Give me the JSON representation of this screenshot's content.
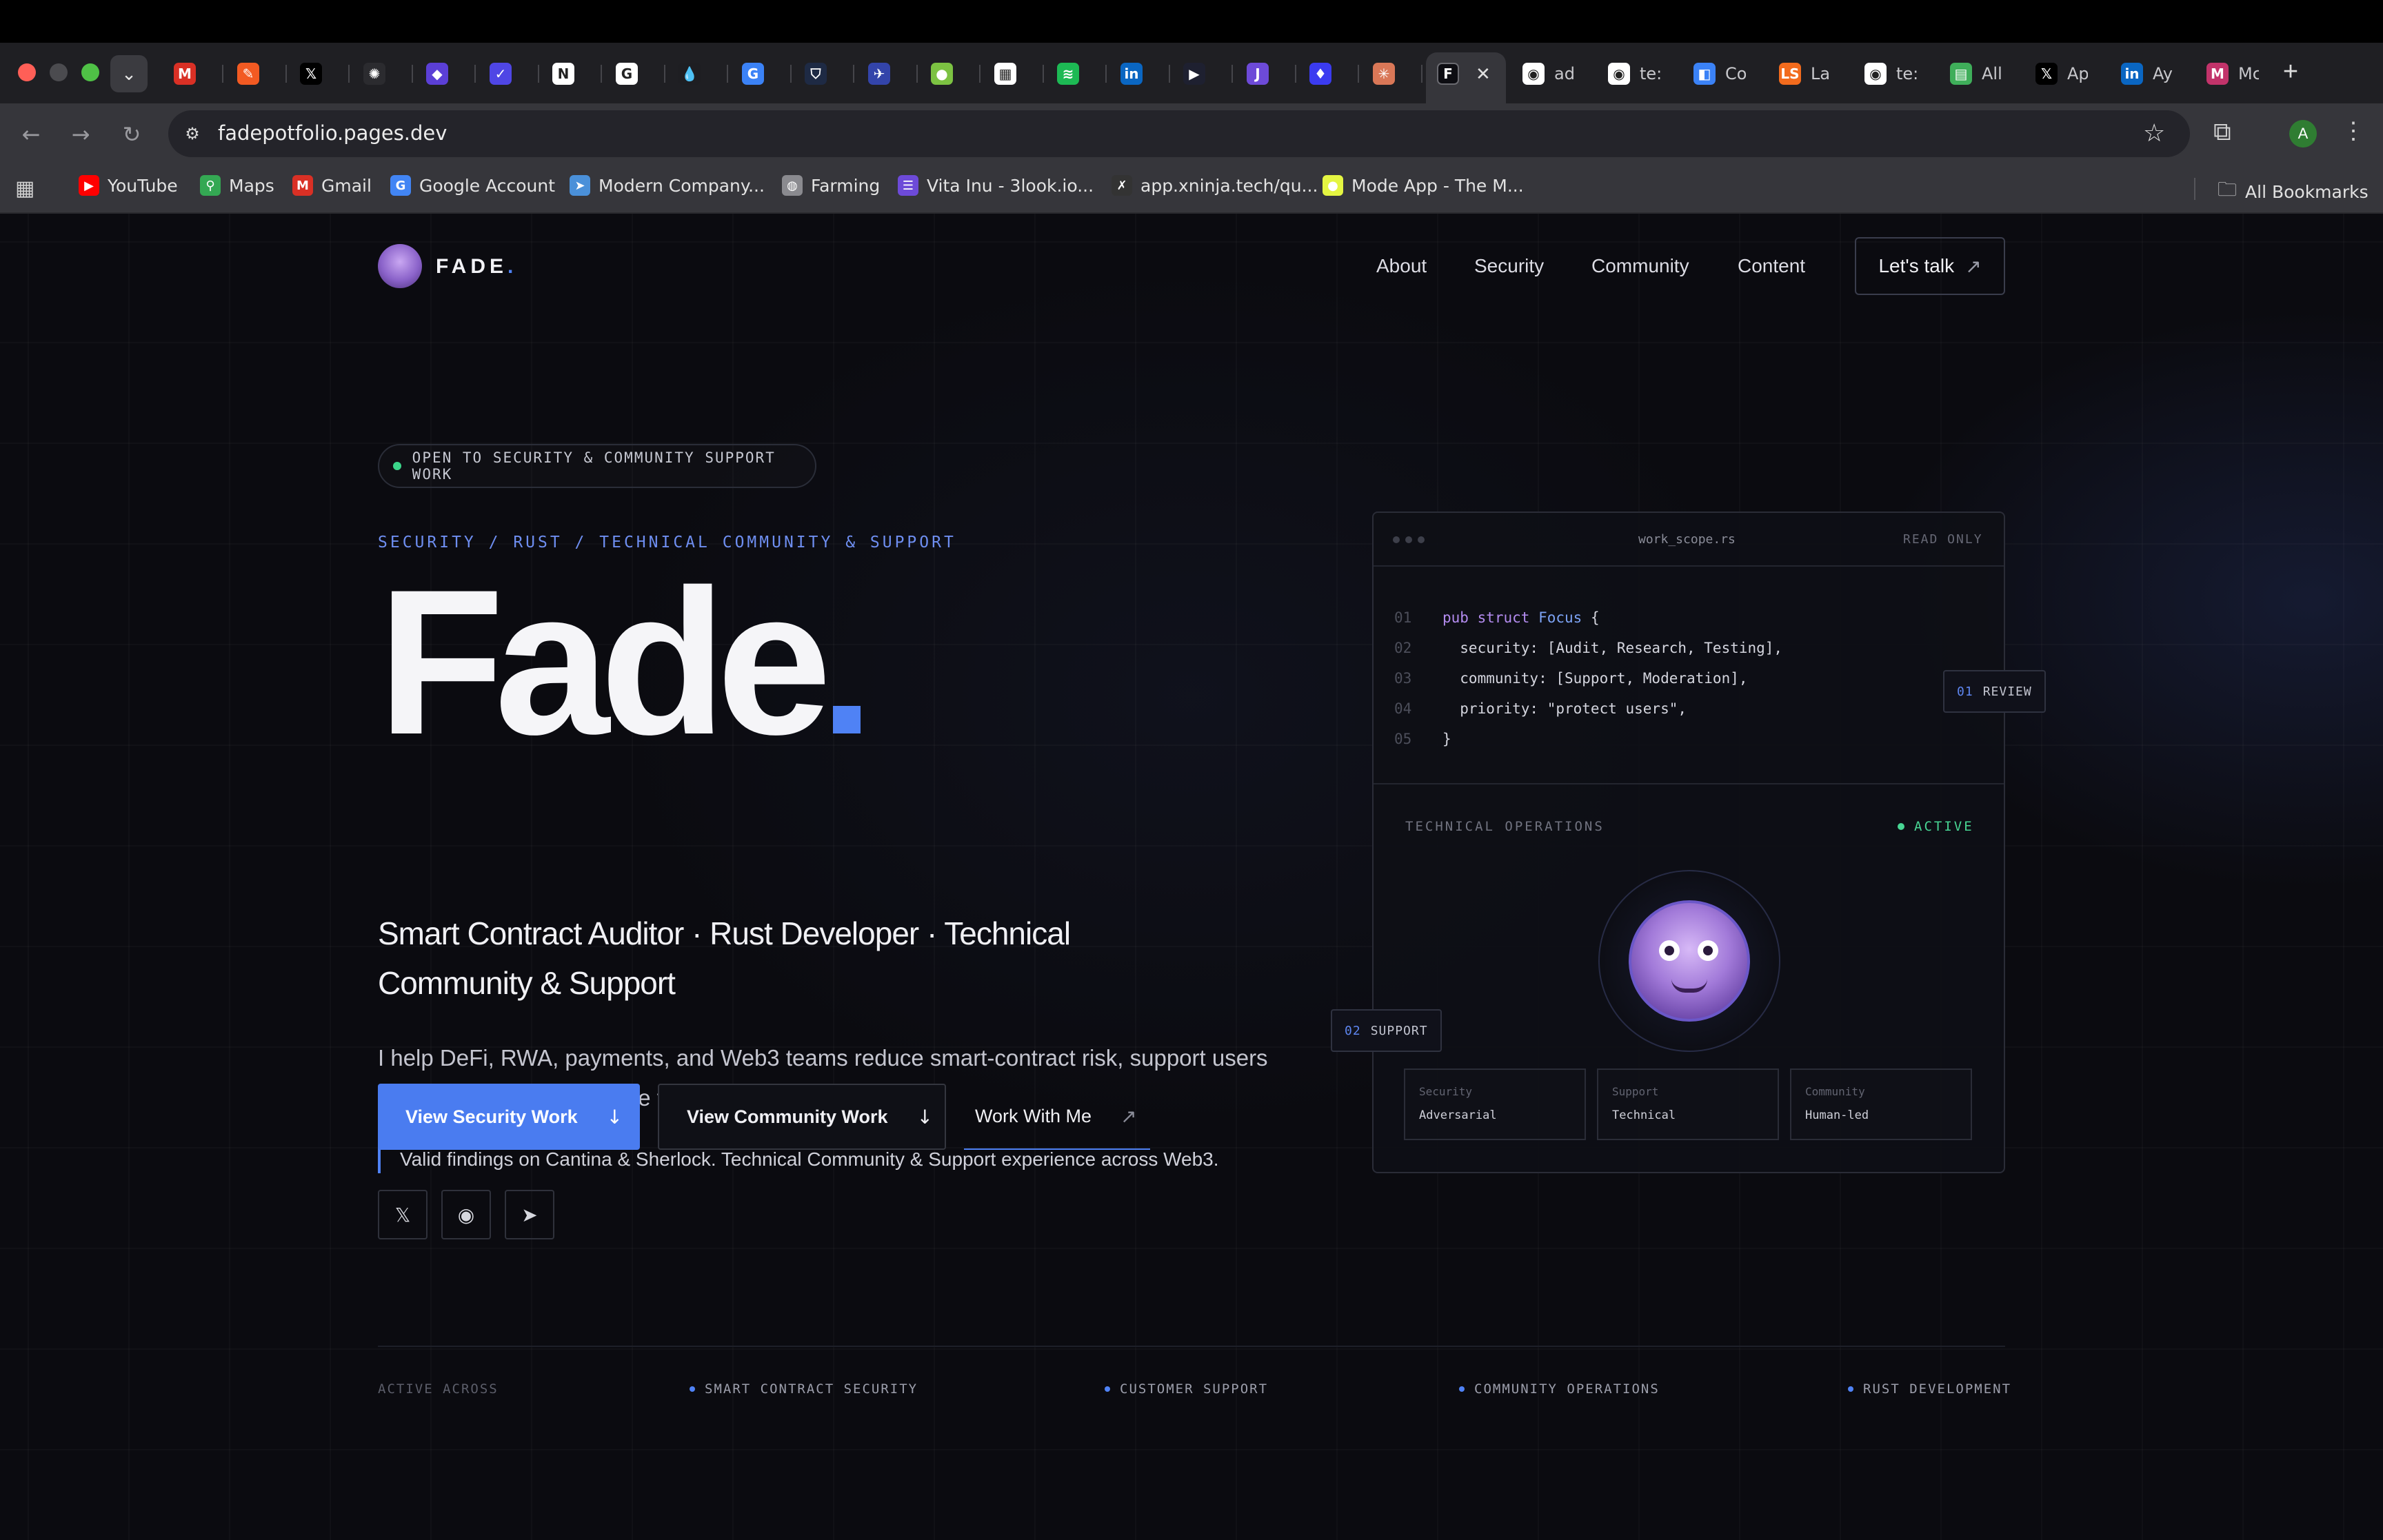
{
  "browser": {
    "tabs": [
      {
        "icon": "gmail-icon",
        "symbol": "M",
        "color": "#d93025",
        "text": ""
      },
      {
        "icon": "app-icon",
        "symbol": "✎",
        "color": "#f25a22",
        "text": ""
      },
      {
        "icon": "x-icon",
        "symbol": "𝕏",
        "color": "#000000",
        "text": ""
      },
      {
        "icon": "openai-icon",
        "symbol": "✺",
        "color": "#2b2b2f",
        "text": ""
      },
      {
        "icon": "cube-icon",
        "symbol": "◆",
        "color": "#5b3fd6",
        "text": ""
      },
      {
        "icon": "check-icon",
        "symbol": "✓",
        "color": "#4f46e5",
        "text": ""
      },
      {
        "icon": "notion-icon",
        "symbol": "N",
        "color": "#ffffff",
        "text": ""
      },
      {
        "icon": "google-icon",
        "symbol": "G",
        "color": "#ffffff",
        "text": ""
      },
      {
        "icon": "drop-icon",
        "symbol": "💧",
        "color": "#1e1e22",
        "text": ""
      },
      {
        "icon": "g-icon",
        "symbol": "G",
        "color": "#3b82f6",
        "text": ""
      },
      {
        "icon": "shield-icon",
        "symbol": "⛉",
        "color": "#1e2a44",
        "text": ""
      },
      {
        "icon": "bird-icon",
        "symbol": "✈",
        "color": "#3344aa",
        "text": ""
      },
      {
        "icon": "globe-icon",
        "symbol": "●",
        "color": "#7cc242",
        "text": ""
      },
      {
        "icon": "doc-icon",
        "symbol": "▦",
        "color": "#ffffff",
        "text": ""
      },
      {
        "icon": "spotify-icon",
        "symbol": "≋",
        "color": "#1db954",
        "text": ""
      },
      {
        "icon": "linkedin-icon",
        "symbol": "in",
        "color": "#0a66c2",
        "text": ""
      },
      {
        "icon": "play-icon",
        "symbol": "▶",
        "color": "#1e2030",
        "text": ""
      },
      {
        "icon": "j-icon",
        "symbol": "J",
        "color": "#6d4ad8",
        "text": ""
      },
      {
        "icon": "droplet-icon",
        "symbol": "♦",
        "color": "#3b3bf0",
        "text": ""
      },
      {
        "icon": "claude-icon",
        "symbol": "✳",
        "color": "#d97757",
        "text": ""
      }
    ],
    "active_tab": {
      "symbol": "F",
      "close": "✕"
    },
    "tabs_right": [
      {
        "icon": "github-icon",
        "symbol": "◉",
        "color": "#ffffff",
        "text": "ad"
      },
      {
        "icon": "github-error-icon",
        "symbol": "◉",
        "color": "#ffffff",
        "text": "te:"
      },
      {
        "icon": "code-icon",
        "symbol": "◧",
        "color": "#3b82f6",
        "text": "Co"
      },
      {
        "icon": "ls-icon",
        "symbol": "LS",
        "color": "#f26b1d",
        "text": "La"
      },
      {
        "icon": "github-icon-2",
        "symbol": "◉",
        "color": "#ffffff",
        "text": "te:"
      },
      {
        "icon": "all-icon",
        "symbol": "▤",
        "color": "#3fae5a",
        "text": "All"
      },
      {
        "icon": "x-icon-2",
        "symbol": "𝕏",
        "color": "#000000",
        "text": "Ap"
      },
      {
        "icon": "linkedin-icon-2",
        "symbol": "in",
        "color": "#0a66c2",
        "text": "Ay"
      },
      {
        "icon": "m-icon",
        "symbol": "M",
        "color": "#c2336a",
        "text": "Mc"
      }
    ],
    "new_tab": "+",
    "url": "fadepotfolio.pages.dev",
    "profile_initial": "A",
    "bookmarks": [
      {
        "label": "YouTube",
        "icon": "youtube-icon",
        "symbol": "▶",
        "color": "#ff0000"
      },
      {
        "label": "Maps",
        "icon": "maps-icon",
        "symbol": "⚲",
        "color": "#34a853"
      },
      {
        "label": "Gmail",
        "icon": "gmail-icon",
        "symbol": "M",
        "color": "#d93025"
      },
      {
        "label": "Google Account",
        "icon": "google-icon",
        "symbol": "G",
        "color": "#4285f4"
      },
      {
        "label": "Modern Company...",
        "icon": "arrow-icon",
        "symbol": "➤",
        "color": "#4a90d9"
      },
      {
        "label": "Farming",
        "icon": "globe-icon",
        "symbol": "◍",
        "color": "#8a8a8f"
      },
      {
        "label": "Vita Inu - 3look.io...",
        "icon": "list-icon",
        "symbol": "☰",
        "color": "#6d4ad8"
      },
      {
        "label": "app.xninja.tech/qu...",
        "icon": "ninja-icon",
        "symbol": "✗",
        "color": "#333333"
      },
      {
        "label": "Mode App - The M...",
        "icon": "mode-icon",
        "symbol": "●",
        "color": "#e4f542"
      }
    ],
    "all_bookmarks": "All Bookmarks"
  },
  "site": {
    "logo_text": "FADE",
    "logo_dot": ".",
    "nav": [
      "About",
      "Security",
      "Community",
      "Content"
    ],
    "cta": "Let's talk",
    "cta_icon": "↗",
    "status": "OPEN TO SECURITY & COMMUNITY SUPPORT WORK",
    "eyebrow": "SECURITY / RUST / TECHNICAL COMMUNITY & SUPPORT",
    "title": "Fade",
    "subtitle": "Smart Contract Auditor · Rust Developer · Technical Community & Support",
    "description": "I help DeFi, RWA, payments, and Web3 teams reduce smart-contract risk, support users properly, and communicate technical products clearly.",
    "quote": "Valid findings on Cantina & Sherlock. Technical Community & Support experience across Web3.",
    "buttons": {
      "security": "View Security Work",
      "community": "View Community Work",
      "work": "Work With Me",
      "down_arrow": "↓",
      "external_arrow": "↗"
    },
    "socials": [
      {
        "name": "x-icon",
        "symbol": "𝕏"
      },
      {
        "name": "github-icon",
        "symbol": "◉"
      },
      {
        "name": "telegram-icon",
        "symbol": "➤"
      }
    ],
    "card": {
      "filename": "work_scope.rs",
      "mode": "READ ONLY",
      "code": [
        {
          "n": "01",
          "kw": "pub struct",
          "ty": "Focus",
          "rest": " {"
        },
        {
          "n": "02",
          "kw": "",
          "ty": "",
          "rest": "  security: [Audit, Research, Testing],"
        },
        {
          "n": "03",
          "kw": "",
          "ty": "",
          "rest": "  community: [Support, Moderation],"
        },
        {
          "n": "04",
          "kw": "",
          "ty": "",
          "rest": "  priority: \"protect users\","
        },
        {
          "n": "05",
          "kw": "",
          "ty": "",
          "rest": "}"
        }
      ],
      "ops_title": "TECHNICAL OPERATIONS",
      "ops_status": "ACTIVE",
      "stats": [
        {
          "k": "Security",
          "v": "Adversarial"
        },
        {
          "k": "Support",
          "v": "Technical"
        },
        {
          "k": "Community",
          "v": "Human-led"
        }
      ],
      "tag_review": {
        "num": "01",
        "label": "REVIEW"
      },
      "tag_support": {
        "num": "02",
        "label": "SUPPORT"
      }
    },
    "footer": {
      "label": "ACTIVE ACROSS",
      "items": [
        "SMART CONTRACT SECURITY",
        "CUSTOMER SUPPORT",
        "COMMUNITY OPERATIONS",
        "RUST DEVELOPMENT"
      ]
    }
  }
}
